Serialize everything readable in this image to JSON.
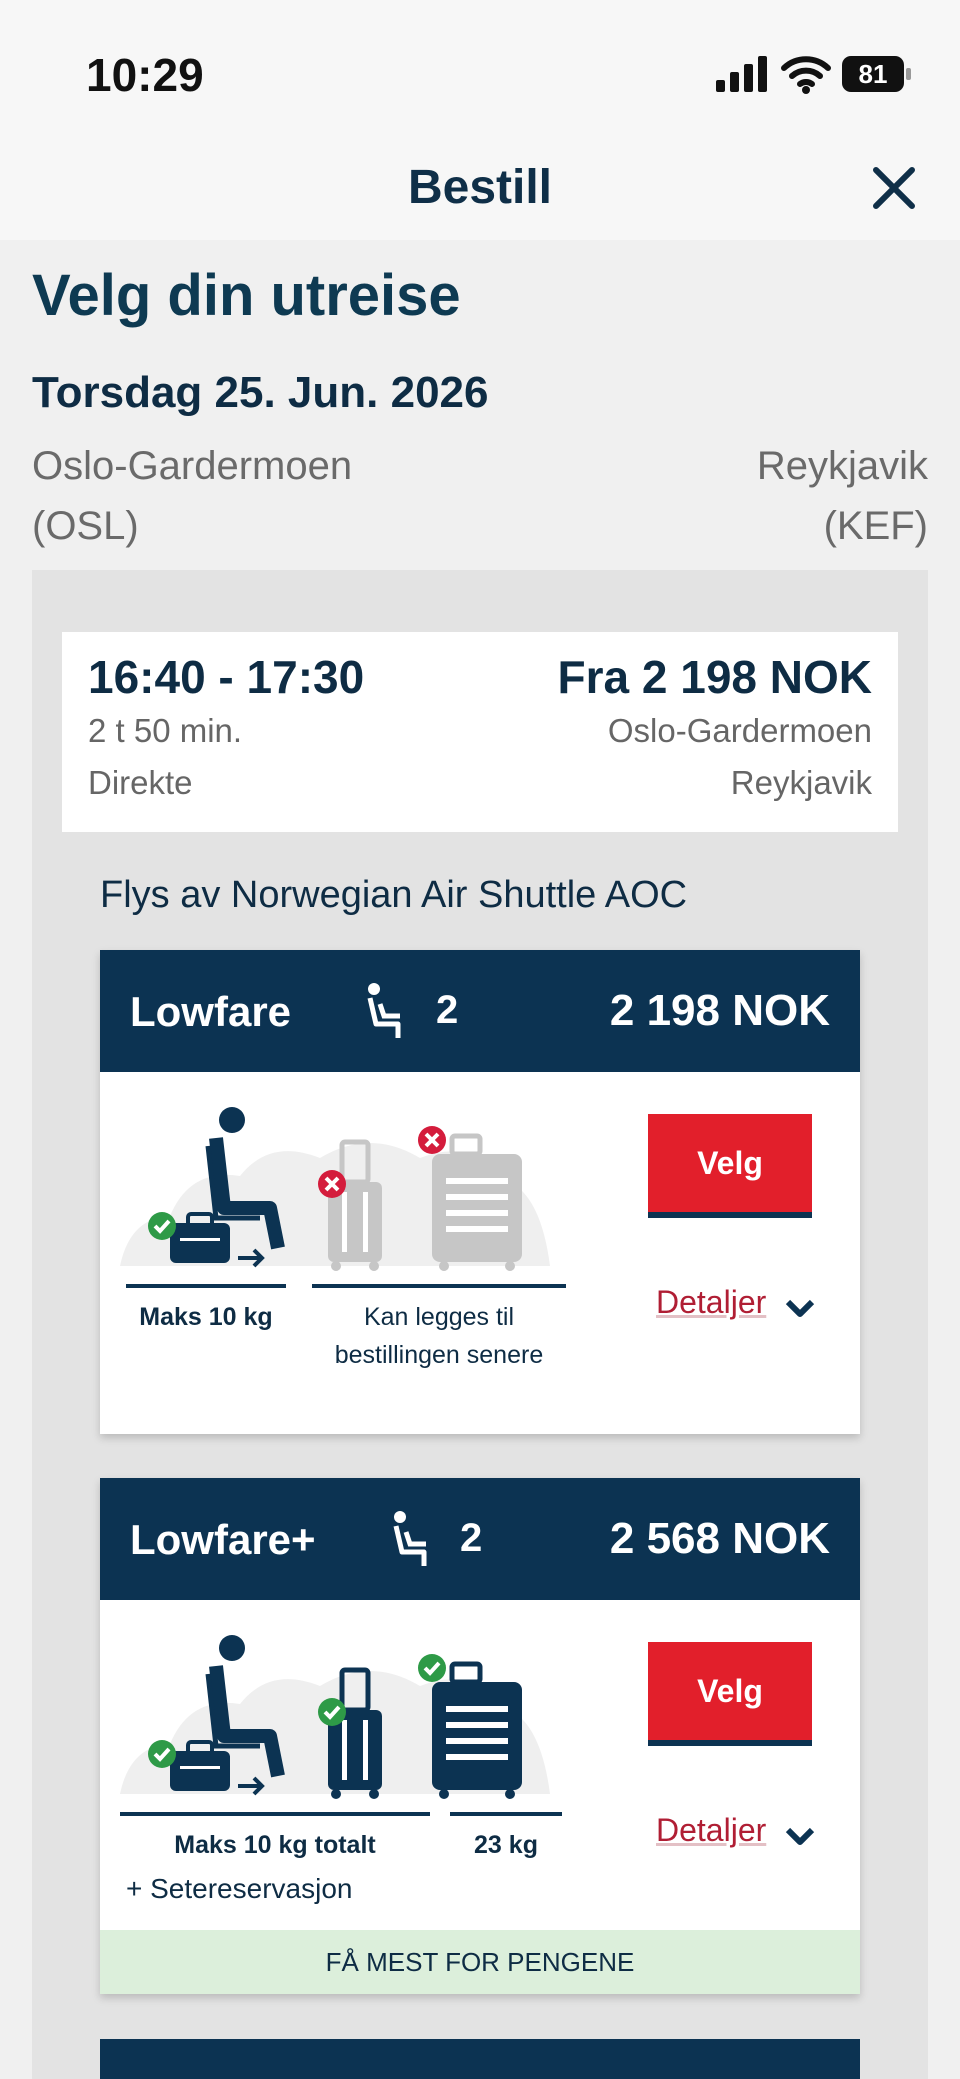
{
  "status_bar": {
    "time": "10:29",
    "battery": "81"
  },
  "nav": {
    "title": "Bestill"
  },
  "page": {
    "title": "Velg din utreise",
    "date": "Torsdag 25. Jun. 2026",
    "origin_city": "Oslo-Gardermoen",
    "origin_code": "(OSL)",
    "dest_city": "Reykjavik",
    "dest_code": "(KEF)"
  },
  "flight": {
    "times": "16:40 - 17:30",
    "duration": "2 t 50 min.",
    "stops": "Direkte",
    "price": "Fra 2 198 NOK",
    "from": "Oslo-Gardermoen",
    "to": "Reykjavik",
    "operated_by": "Flys av Norwegian Air Shuttle AOC"
  },
  "fares": [
    {
      "name": "Lowfare",
      "seats": "2",
      "price": "2 198 NOK",
      "select_label": "Velg",
      "details_label": "Detaljer",
      "label_carry_on": "Maks 10 kg",
      "label_checked_line1": "Kan legges til",
      "label_checked_line2": "bestillingen senere"
    },
    {
      "name": "Lowfare+",
      "seats": "2",
      "price": "2 568 NOK",
      "select_label": "Velg",
      "details_label": "Detaljer",
      "label_carry_on": "Maks 10 kg totalt",
      "label_checked": "23 kg",
      "extra": "+ Setereservasjon",
      "badge": "FÅ MEST FOR PENGENE"
    }
  ],
  "colors": {
    "navy": "#0c3352",
    "red": "#e21f2b",
    "green": "#2e9a47",
    "banner": "#dcefdb"
  }
}
